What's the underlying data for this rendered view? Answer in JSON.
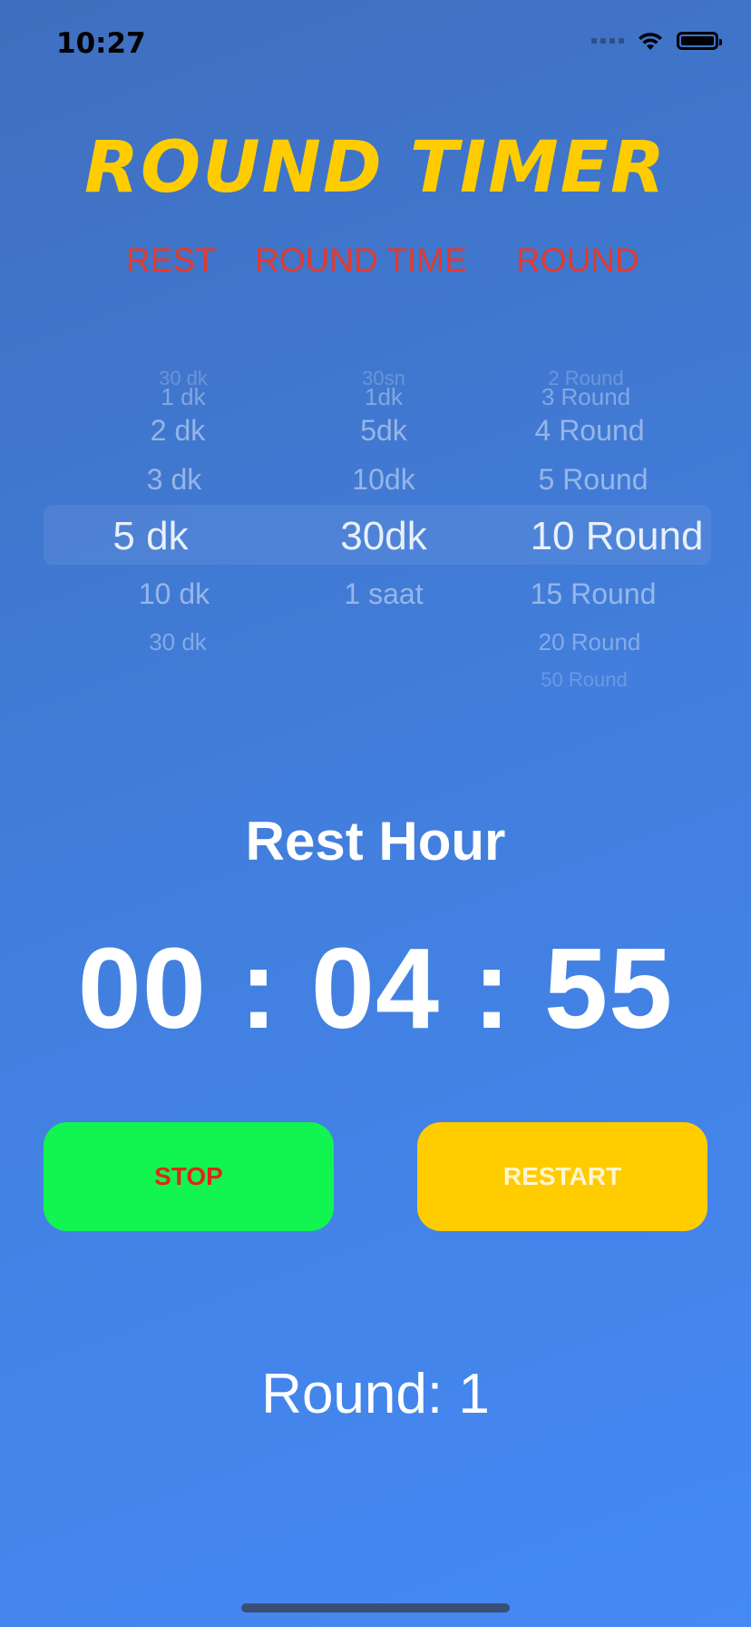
{
  "status_bar": {
    "time": "10:27",
    "wifi_icon": "wifi-icon",
    "battery_icon": "battery-icon"
  },
  "title": "ROUND TIMER",
  "headers": {
    "rest": "REST",
    "round_time": "ROUND TIME",
    "round": "ROUND"
  },
  "pickers": {
    "rest": {
      "edge_top": "30 dk",
      "far_top": "1 dk",
      "above2": "2 dk",
      "above1": "3 dk",
      "selected": "5 dk",
      "below1": "10 dk",
      "below2": "30 dk"
    },
    "round_time": {
      "edge_top": "30sn",
      "far_top": "1dk",
      "above2": "5dk",
      "above1": "10dk",
      "selected": "30dk",
      "below1": "1 saat"
    },
    "round": {
      "edge_top": "2 Round",
      "far_top": "3 Round",
      "above2": "4 Round",
      "above1": "5 Round",
      "selected": "10 Round",
      "below1": "15 Round",
      "below2": "20 Round",
      "edge_bottom": "50 Round"
    }
  },
  "timer": {
    "label": "Rest Hour",
    "display": "00 : 04 : 55"
  },
  "buttons": {
    "stop": "STOP",
    "restart": "RESTART"
  },
  "round_status": "Round: 1",
  "colors": {
    "title": "#ffcc00",
    "headers": "#e33a2c",
    "stop_bg": "#12f550",
    "restart_bg": "#ffcc00"
  }
}
